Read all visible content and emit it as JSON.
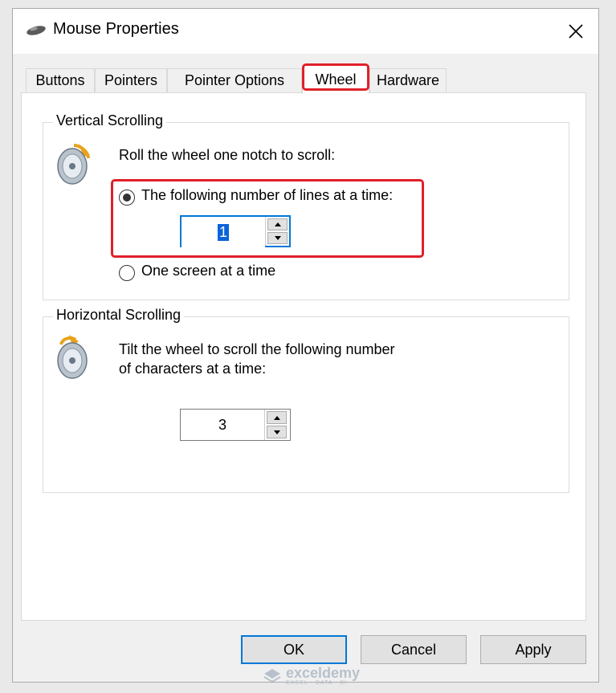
{
  "window": {
    "title": "Mouse Properties",
    "close_glyph": "✕"
  },
  "tabs": [
    {
      "label": "Buttons",
      "active": false
    },
    {
      "label": "Pointers",
      "active": false
    },
    {
      "label": "Pointer Options",
      "active": false
    },
    {
      "label": "Wheel",
      "active": true
    },
    {
      "label": "Hardware",
      "active": false
    }
  ],
  "vertical": {
    "group_label": "Vertical Scrolling",
    "instruction": "Roll the wheel one notch to scroll:",
    "option_lines_label": "The following number of lines at a time:",
    "option_lines_selected": true,
    "lines_value": "1",
    "option_screen_label": "One screen at a time",
    "option_screen_selected": false
  },
  "horizontal": {
    "group_label": "Horizontal Scrolling",
    "instruction_line1": "Tilt the wheel to scroll the following number",
    "instruction_line2": "of characters at a time:",
    "chars_value": "3"
  },
  "buttons": {
    "ok": "OK",
    "cancel": "Cancel",
    "apply": "Apply"
  },
  "watermark": {
    "brand": "exceldemy",
    "tagline": "EXCEL · DATA · BI"
  },
  "colors": {
    "highlight": "#e0202a",
    "accent": "#0078d7",
    "selection": "#0a64d8"
  }
}
